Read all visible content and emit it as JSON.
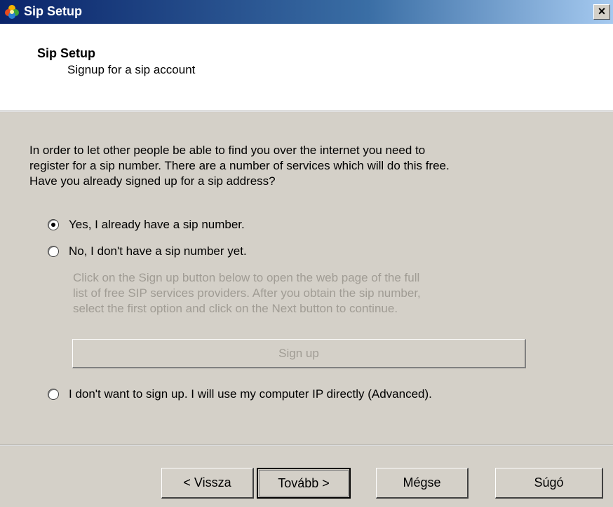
{
  "window": {
    "title": "Sip Setup",
    "close_label": "×",
    "icon": "app-flower-icon"
  },
  "header": {
    "title": "Sip Setup",
    "subtitle": "Signup for a sip account"
  },
  "intro": {
    "line1": "In order to let other people be able to find you over the internet you need to",
    "line2": "register for a sip number. There are a number of services which will do this free.",
    "line3": "Have you already signed up for a sip address?"
  },
  "options": [
    {
      "label": "Yes, I already have a sip number.",
      "checked": true
    },
    {
      "label": "No, I don't have a sip number yet.",
      "checked": false
    },
    {
      "label": "I don't want to sign up. I will use my computer IP directly (Advanced).",
      "checked": false
    }
  ],
  "help_text": {
    "line1": "Click on the Sign up button below to open the web page of the full",
    "line2": "list of free SIP services providers. After you obtain the sip number,",
    "line3": "select the first option and click on the Next button to continue."
  },
  "signup_button": "Sign up",
  "footer": {
    "back": "< Vissza",
    "next": "Tovább >",
    "cancel": "Mégse",
    "help": "Súgó"
  }
}
